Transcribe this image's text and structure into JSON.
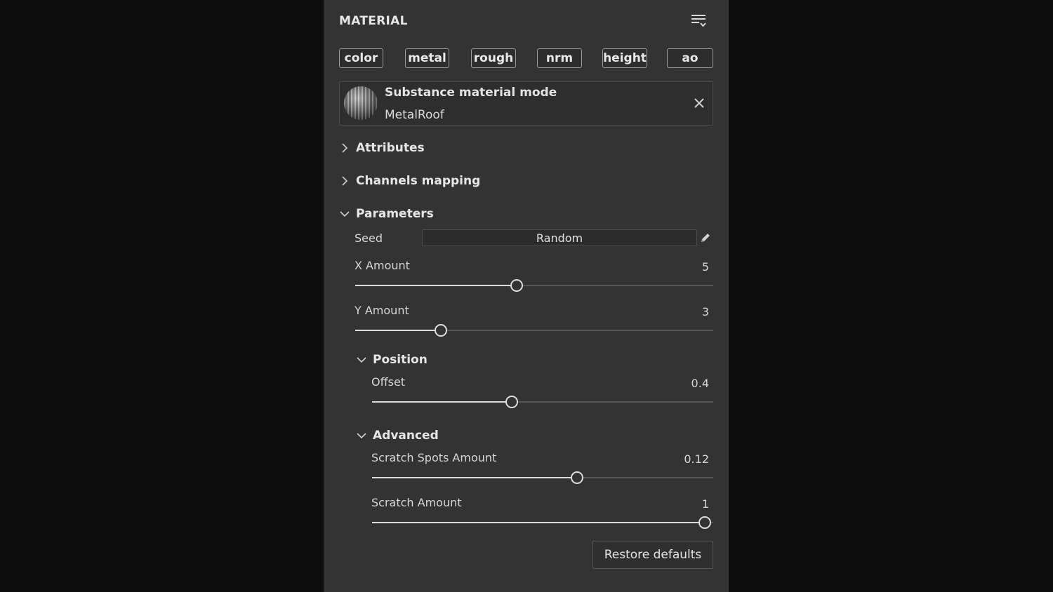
{
  "panel": {
    "title": "MATERIAL",
    "menu_icon": "list-filter-icon"
  },
  "channels": [
    "color",
    "metal",
    "rough",
    "nrm",
    "height",
    "ao"
  ],
  "material": {
    "mode_title": "Substance material mode",
    "name": "MetalRoof",
    "thumbnail_icon": "metal-sphere-preview",
    "close_icon": "close-icon"
  },
  "sections": {
    "attributes": "Attributes",
    "channels_mapping": "Channels mapping",
    "parameters": "Parameters",
    "position": "Position",
    "advanced": "Advanced"
  },
  "params": {
    "seed": {
      "label": "Seed",
      "value": "Random",
      "edit_icon": "pencil-icon"
    },
    "x_amount": {
      "label": "X Amount",
      "value": "5",
      "fraction": 0.45
    },
    "y_amount": {
      "label": "Y Amount",
      "value": "3",
      "fraction": 0.24
    },
    "offset": {
      "label": "Offset",
      "value": "0.4",
      "fraction": 0.41
    },
    "scratch_spots": {
      "label": "Scratch Spots Amount",
      "value": "0.12",
      "fraction": 0.6
    },
    "scratch_amount": {
      "label": "Scratch Amount",
      "value": "1",
      "fraction": 0.975
    }
  },
  "footer": {
    "restore_label": "Restore defaults"
  },
  "colors": {
    "panel_bg": "#333333",
    "page_bg": "#0d0d0d",
    "accent": "#dcdcdc"
  }
}
